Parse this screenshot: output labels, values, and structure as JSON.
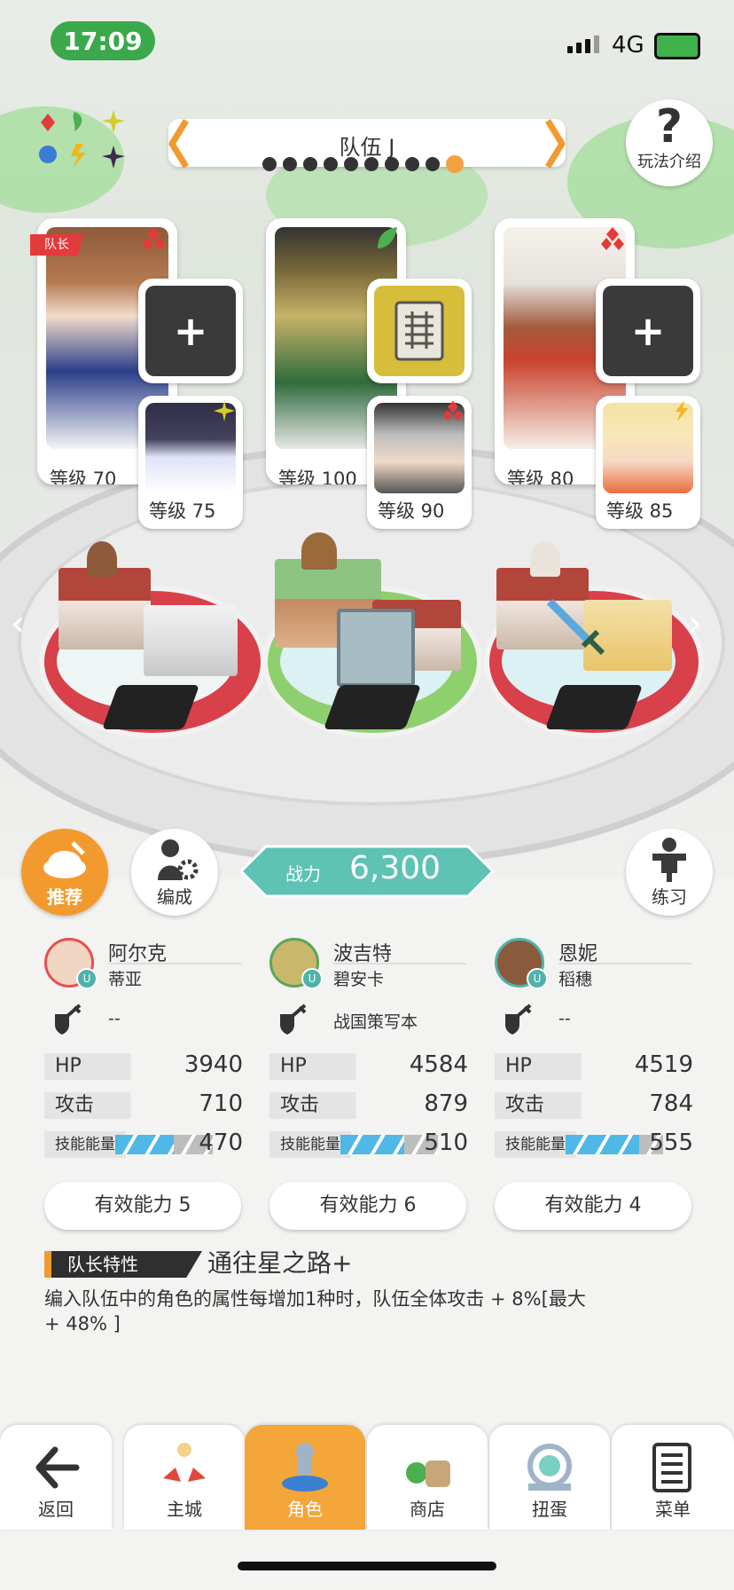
{
  "status_bar": {
    "time": "17:09",
    "network": "4G"
  },
  "header": {
    "team_title": "队伍 J",
    "page_count": 10,
    "active_page": 10,
    "help_label": "玩法介绍"
  },
  "lineup": [
    {
      "badge": "队长",
      "element": "diamond",
      "level": "等级 70",
      "sub_element": "sparkle",
      "sub_level": "等级 75",
      "equip_slot": "empty",
      "colors": {
        "main": "#e94e4e",
        "portrait_bg": "#f3e3d6"
      }
    },
    {
      "badge": "",
      "element": "leaf",
      "level": "等级 100",
      "sub_element": "diamond",
      "sub_level": "等级 90",
      "equip_slot": "book",
      "colors": {
        "main": "#5aa65a",
        "portrait_bg": "#2e5e36"
      }
    },
    {
      "badge": "",
      "element": "diamond",
      "level": "等级 80",
      "sub_element": "lightning",
      "sub_level": "等级 85",
      "equip_slot": "empty",
      "colors": {
        "main": "#e94e4e",
        "portrait_bg": "#f6efe7"
      }
    }
  ],
  "actions": {
    "recommend": "推荐",
    "formation": "编成",
    "power_label": "战力",
    "power_value": "6,300",
    "practice": "练习"
  },
  "heroes": [
    {
      "name": "阿尔克",
      "partner": "蒂亚",
      "weapon": "--",
      "hp_label": "HP",
      "hp": "3940",
      "atk_label": "攻击",
      "atk": "710",
      "skill_label": "技能能量",
      "skill": "470",
      "skill_fill": 0.6,
      "effective": "有效能力 5"
    },
    {
      "name": "波吉特",
      "partner": "碧安卡",
      "weapon": "战国策写本",
      "hp_label": "HP",
      "hp": "4584",
      "atk_label": "攻击",
      "atk": "879",
      "skill_label": "技能能量",
      "skill": "510",
      "skill_fill": 0.65,
      "effective": "有效能力 6"
    },
    {
      "name": "恩妮",
      "partner": "稻穗",
      "weapon": "--",
      "hp_label": "HP",
      "hp": "4519",
      "atk_label": "攻击",
      "atk": "784",
      "skill_label": "技能能量",
      "skill": "555",
      "skill_fill": 0.75,
      "effective": "有效能力 4"
    }
  ],
  "leader_trait": {
    "tag": "队长特性",
    "name": "通往星之路+",
    "desc_line1": "编入队伍中的角色的属性每增加1种时，队伍全体攻击 + 8%[最大",
    "desc_line2": "+ 48% ]"
  },
  "nav": {
    "back": "返回",
    "items": [
      "主城",
      "角色",
      "商店",
      "扭蛋",
      "菜单"
    ],
    "active": "角色"
  },
  "colors": {
    "accent": "#f4a63a",
    "power": "#5ec2b4",
    "skill_bar": "#4fb8e6"
  }
}
